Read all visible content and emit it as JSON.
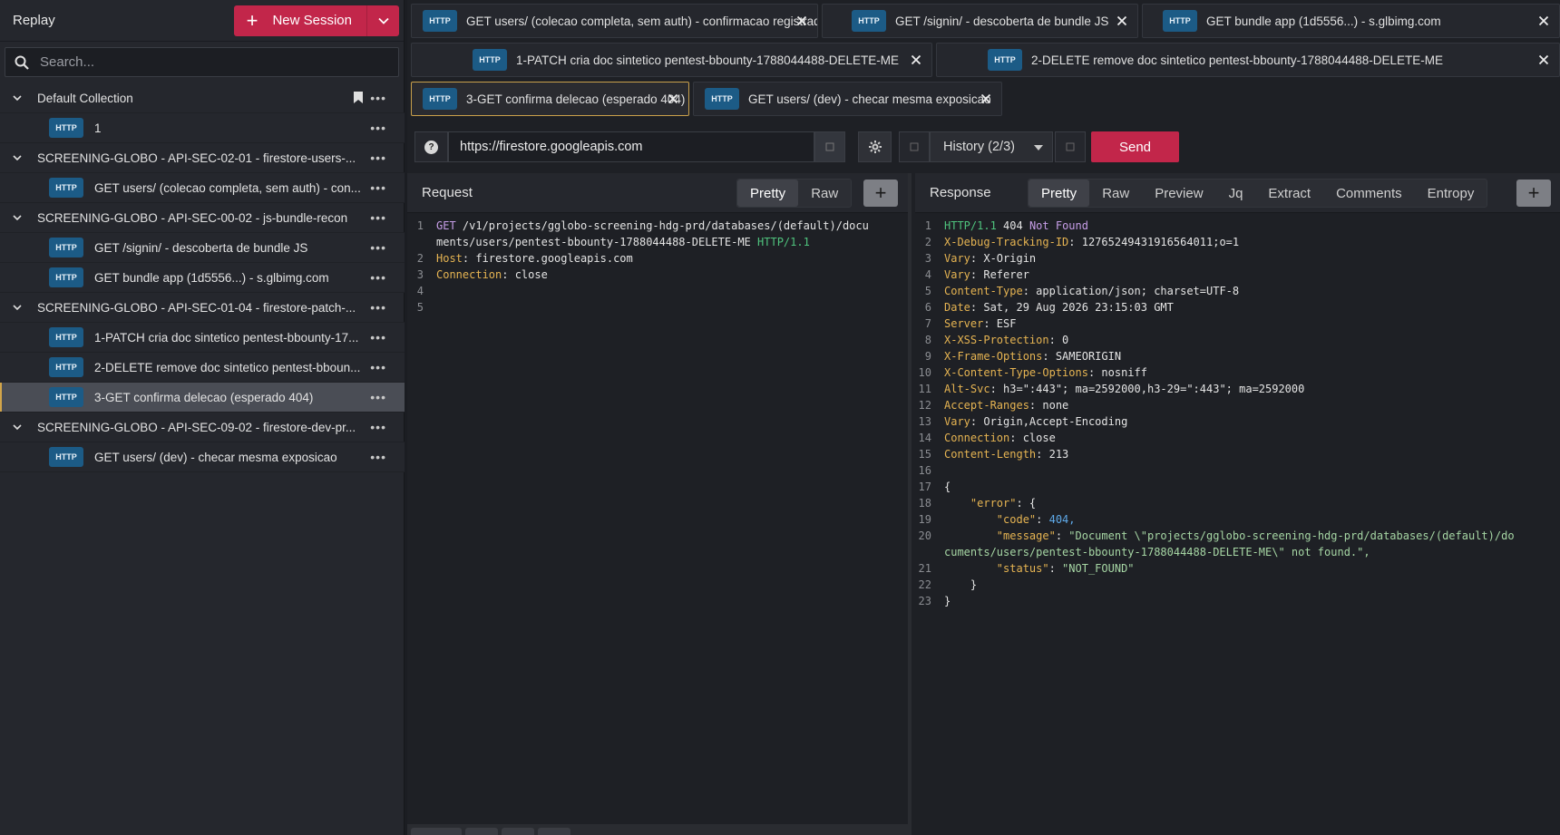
{
  "sidebar": {
    "title": "Replay",
    "new_session_label": "New Session",
    "search_placeholder": "Search...",
    "rows": [
      {
        "type": "group",
        "label": "Default Collection"
      },
      {
        "type": "item",
        "badge": "HTTP",
        "label": "1"
      },
      {
        "type": "group",
        "label": "SCREENING-GLOBO - API-SEC-02-01 - firestore-users-..."
      },
      {
        "type": "item",
        "badge": "HTTP",
        "label": "GET users/ (colecao completa, sem auth) - con..."
      },
      {
        "type": "group",
        "label": "SCREENING-GLOBO - API-SEC-00-02 - js-bundle-recon"
      },
      {
        "type": "item",
        "badge": "HTTP",
        "label": "GET /signin/ - descoberta de bundle JS"
      },
      {
        "type": "item",
        "badge": "HTTP",
        "label": "GET bundle app (1d5556...) - s.glbimg.com"
      },
      {
        "type": "group",
        "label": "SCREENING-GLOBO - API-SEC-01-04 - firestore-patch-..."
      },
      {
        "type": "item",
        "badge": "HTTP",
        "label": "1-PATCH cria doc sintetico pentest-bbounty-17..."
      },
      {
        "type": "item",
        "badge": "HTTP",
        "label": "2-DELETE remove doc sintetico pentest-bboun..."
      },
      {
        "type": "item",
        "badge": "HTTP",
        "label": "3-GET confirma delecao (esperado 404)",
        "active": true
      },
      {
        "type": "group",
        "label": "SCREENING-GLOBO - API-SEC-09-02 - firestore-dev-pr..."
      },
      {
        "type": "item",
        "badge": "HTTP",
        "label": "GET users/ (dev) - checar mesma exposicao"
      }
    ]
  },
  "tabs": [
    {
      "badge": "HTTP",
      "label": "GET users/ (colecao completa, sem auth) - confirmacao registrada"
    },
    {
      "badge": "HTTP",
      "label": "GET /signin/ - descoberta de bundle JS"
    },
    {
      "badge": "HTTP",
      "label": "GET bundle app (1d5556...) - s.glbimg.com"
    },
    {
      "badge": "HTTP",
      "label": "1-PATCH cria doc sintetico pentest-bbounty-1788044488-DELETE-ME"
    },
    {
      "badge": "HTTP",
      "label": "2-DELETE remove doc sintetico pentest-bbounty-1788044488-DELETE-ME"
    },
    {
      "badge": "HTTP",
      "label": "3-GET confirma delecao (esperado 404)",
      "active": true
    },
    {
      "badge": "HTTP",
      "label": "GET users/ (dev) - checar mesma exposicao"
    }
  ],
  "urlbar": {
    "help": "?",
    "url": "https://firestore.googleapis.com",
    "history": "History (2/3)",
    "send": "Send"
  },
  "request": {
    "title": "Request",
    "views": [
      "Pretty",
      "Raw"
    ],
    "lines": [
      {
        "n": "1",
        "method": "GET",
        "path": " /v1/projects/gglobo-screening-hdg-prd/databases/(default)/docu",
        "cont": "ments/users/pentest-bbounty-1788044488-DELETE-ME",
        "proto": "HTTP/1.1"
      },
      {
        "n": "2",
        "key": "Host",
        "val": ": firestore.googleapis.com"
      },
      {
        "n": "3",
        "key": "Connection",
        "val": ": close"
      },
      {
        "n": "4"
      },
      {
        "n": "5"
      }
    ]
  },
  "response": {
    "title": "Response",
    "views": [
      "Pretty",
      "Raw",
      "Preview",
      "Jq",
      "Extract",
      "Comments",
      "Entropy"
    ],
    "status_proto": "HTTP/1.1",
    "status_code": "404",
    "status_text": "Not Found",
    "headers": [
      {
        "n": "2",
        "key": "X-Debug-Tracking-ID",
        "val": ": 12765249431916564011;o=1"
      },
      {
        "n": "3",
        "key": "Vary",
        "val": ": X-Origin"
      },
      {
        "n": "4",
        "key": "Vary",
        "val": ": Referer"
      },
      {
        "n": "5",
        "key": "Content-Type",
        "val": ": application/json; charset=UTF-8"
      },
      {
        "n": "6",
        "key": "Date",
        "val": ": Sat, 29 Aug 2026 23:15:03 GMT"
      },
      {
        "n": "7",
        "key": "Server",
        "val": ": ESF"
      },
      {
        "n": "8",
        "key": "X-XSS-Protection",
        "val": ": 0"
      },
      {
        "n": "9",
        "key": "X-Frame-Options",
        "val": ": SAMEORIGIN"
      },
      {
        "n": "10",
        "key": "X-Content-Type-Options",
        "val": ": nosniff"
      },
      {
        "n": "11",
        "key": "Alt-Svc",
        "val": ": h3=\":443\"; ma=2592000,h3-29=\":443\"; ma=2592000"
      },
      {
        "n": "12",
        "key": "Accept-Ranges",
        "val": ": none"
      },
      {
        "n": "13",
        "key": "Vary",
        "val": ": Origin,Accept-Encoding"
      },
      {
        "n": "14",
        "key": "Connection",
        "val": ": close"
      },
      {
        "n": "15",
        "key": "Content-Length",
        "val": ": 213"
      }
    ],
    "body": {
      "open": "{",
      "error_key": "\"error\"",
      "code_key": "\"code\"",
      "code_val": "404",
      "message_key": "\"message\"",
      "message_val_1": "\"Document \\\"projects/gglobo-screening-hdg-prd/databases/(default)/do",
      "message_val_2": "cuments/users/pentest-bbounty-1788044488-DELETE-ME\\\" not found.\"",
      "status_key": "\"status\"",
      "status_val": "\"NOT_FOUND\"",
      "close_inner": "}",
      "close": "}"
    }
  }
}
